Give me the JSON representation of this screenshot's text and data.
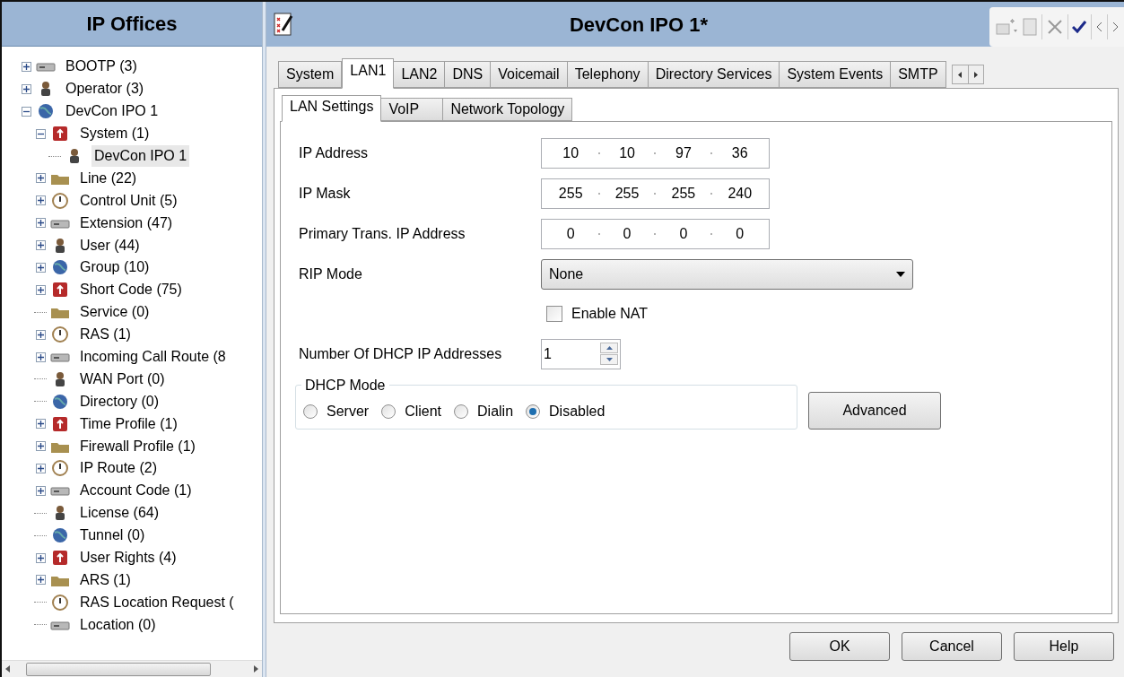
{
  "navigator": {
    "title": "IP Offices",
    "tree": [
      {
        "label": "BOOTP (3)",
        "kind": "collapsed",
        "selected": false
      },
      {
        "label": "Operator (3)",
        "kind": "collapsed",
        "selected": false
      },
      {
        "label": "DevCon IPO 1",
        "kind": "expanded",
        "selected": false,
        "children": [
          {
            "label": "System (1)",
            "kind": "expanded",
            "selected": false,
            "children": [
              {
                "label": "DevCon IPO 1",
                "kind": "leaf",
                "selected": true
              }
            ]
          },
          {
            "label": "Line (22)",
            "kind": "collapsed",
            "selected": false
          },
          {
            "label": "Control Unit (5)",
            "kind": "collapsed",
            "selected": false
          },
          {
            "label": "Extension (47)",
            "kind": "collapsed",
            "selected": false
          },
          {
            "label": "User (44)",
            "kind": "collapsed",
            "selected": false
          },
          {
            "label": "Group (10)",
            "kind": "collapsed",
            "selected": false
          },
          {
            "label": "Short Code (75)",
            "kind": "collapsed",
            "selected": false
          },
          {
            "label": "Service (0)",
            "kind": "leaf",
            "selected": false
          },
          {
            "label": "RAS (1)",
            "kind": "collapsed",
            "selected": false
          },
          {
            "label": "Incoming Call Route (8",
            "kind": "collapsed",
            "selected": false
          },
          {
            "label": "WAN Port (0)",
            "kind": "leaf",
            "selected": false
          },
          {
            "label": "Directory (0)",
            "kind": "leaf",
            "selected": false
          },
          {
            "label": "Time Profile (1)",
            "kind": "collapsed",
            "selected": false
          },
          {
            "label": "Firewall Profile (1)",
            "kind": "collapsed",
            "selected": false
          },
          {
            "label": "IP Route (2)",
            "kind": "collapsed",
            "selected": false
          },
          {
            "label": "Account Code (1)",
            "kind": "collapsed",
            "selected": false
          },
          {
            "label": "License (64)",
            "kind": "leaf",
            "selected": false
          },
          {
            "label": "Tunnel (0)",
            "kind": "leaf",
            "selected": false
          },
          {
            "label": "User Rights (4)",
            "kind": "collapsed",
            "selected": false
          },
          {
            "label": "ARS (1)",
            "kind": "collapsed",
            "selected": false
          },
          {
            "label": "RAS Location Request (",
            "kind": "leaf",
            "selected": false
          },
          {
            "label": "Location (0)",
            "kind": "leaf",
            "selected": false
          }
        ]
      }
    ]
  },
  "editor": {
    "title": "DevCon IPO 1*",
    "tabs": [
      {
        "label": "System",
        "selected": false
      },
      {
        "label": "LAN1",
        "selected": true
      },
      {
        "label": "LAN2",
        "selected": false
      },
      {
        "label": "DNS",
        "selected": false
      },
      {
        "label": "Voicemail",
        "selected": false
      },
      {
        "label": "Telephony",
        "selected": false
      },
      {
        "label": "Directory Services",
        "selected": false
      },
      {
        "label": "System Events",
        "selected": false
      },
      {
        "label": "SMTP",
        "selected": false
      }
    ],
    "subtabs": [
      {
        "label": "LAN Settings",
        "selected": true
      },
      {
        "label": "VoIP",
        "selected": false
      },
      {
        "label": "Network Topology",
        "selected": false
      }
    ],
    "fields": [
      {
        "kind": "ip",
        "label": "IP Address",
        "octets": [
          "10",
          "10",
          "97",
          "36"
        ]
      },
      {
        "kind": "ip",
        "label": "IP Mask",
        "octets": [
          "255",
          "255",
          "255",
          "240"
        ]
      },
      {
        "kind": "ip",
        "label": "Primary Trans. IP Address",
        "octets": [
          "0",
          "0",
          "0",
          "0"
        ]
      },
      {
        "kind": "select",
        "label": "RIP Mode",
        "value": "None"
      },
      {
        "kind": "checkbox",
        "label": "Enable NAT",
        "checked": false
      },
      {
        "kind": "spinner",
        "label": "Number Of DHCP IP Addresses",
        "value": "1"
      }
    ],
    "dhcp_mode": {
      "legend": "DHCP Mode",
      "options": [
        {
          "label": "Server",
          "selected": false
        },
        {
          "label": "Client",
          "selected": false
        },
        {
          "label": "Dialin",
          "selected": false
        },
        {
          "label": "Disabled",
          "selected": true
        }
      ],
      "button": "Advanced"
    },
    "buttons": [
      "OK",
      "Cancel",
      "Help"
    ]
  }
}
